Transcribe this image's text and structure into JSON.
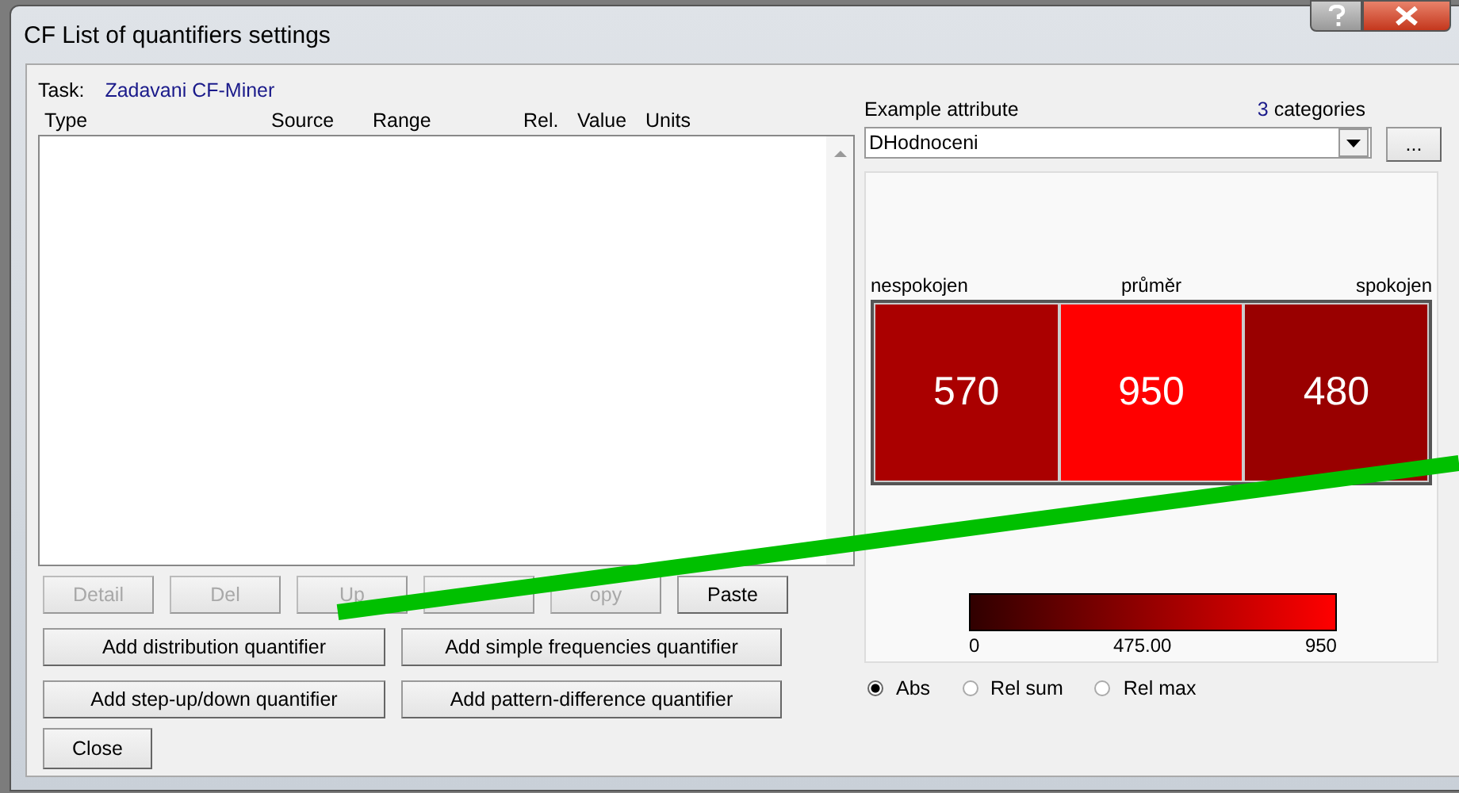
{
  "window": {
    "title": "CF List of quantifiers settings"
  },
  "task": {
    "label": "Task:",
    "value": "Zadavani CF-Miner"
  },
  "list": {
    "columns": [
      "Type",
      "Source",
      "Range",
      "Rel.",
      "Value",
      "Units"
    ]
  },
  "row_buttons": [
    {
      "label": "Detail",
      "disabled": true
    },
    {
      "label": "Del",
      "disabled": true
    },
    {
      "label": "Up",
      "disabled": true
    },
    {
      "disabled": true
    },
    {
      "label": "opy",
      "disabled": true
    },
    {
      "label": "Paste",
      "disabled": false
    }
  ],
  "add_buttons": [
    "Add distribution quantifier",
    "Add simple frequencies quantifier",
    "Add step-up/down quantifier",
    "Add pattern-difference quantifier"
  ],
  "close_button": "Close",
  "attribute": {
    "label": "Example attribute",
    "count": "3",
    "count_label": "categories",
    "value": "DHodnoceni",
    "browse": "..."
  },
  "heatmap": {
    "cells": [
      {
        "label": "nespokojen",
        "color": "#aa0000",
        "text": "570"
      },
      {
        "label": "průměr",
        "color": "#ff0000",
        "text": "950"
      },
      {
        "label": "spokojen",
        "color": "#990000",
        "text": "480"
      }
    ],
    "scale": [
      "0",
      "475.00",
      "950"
    ]
  },
  "modes": [
    {
      "label": "Abs",
      "selected": true
    },
    {
      "label": "Rel sum",
      "selected": false
    },
    {
      "label": "Rel max",
      "selected": false
    }
  ]
}
